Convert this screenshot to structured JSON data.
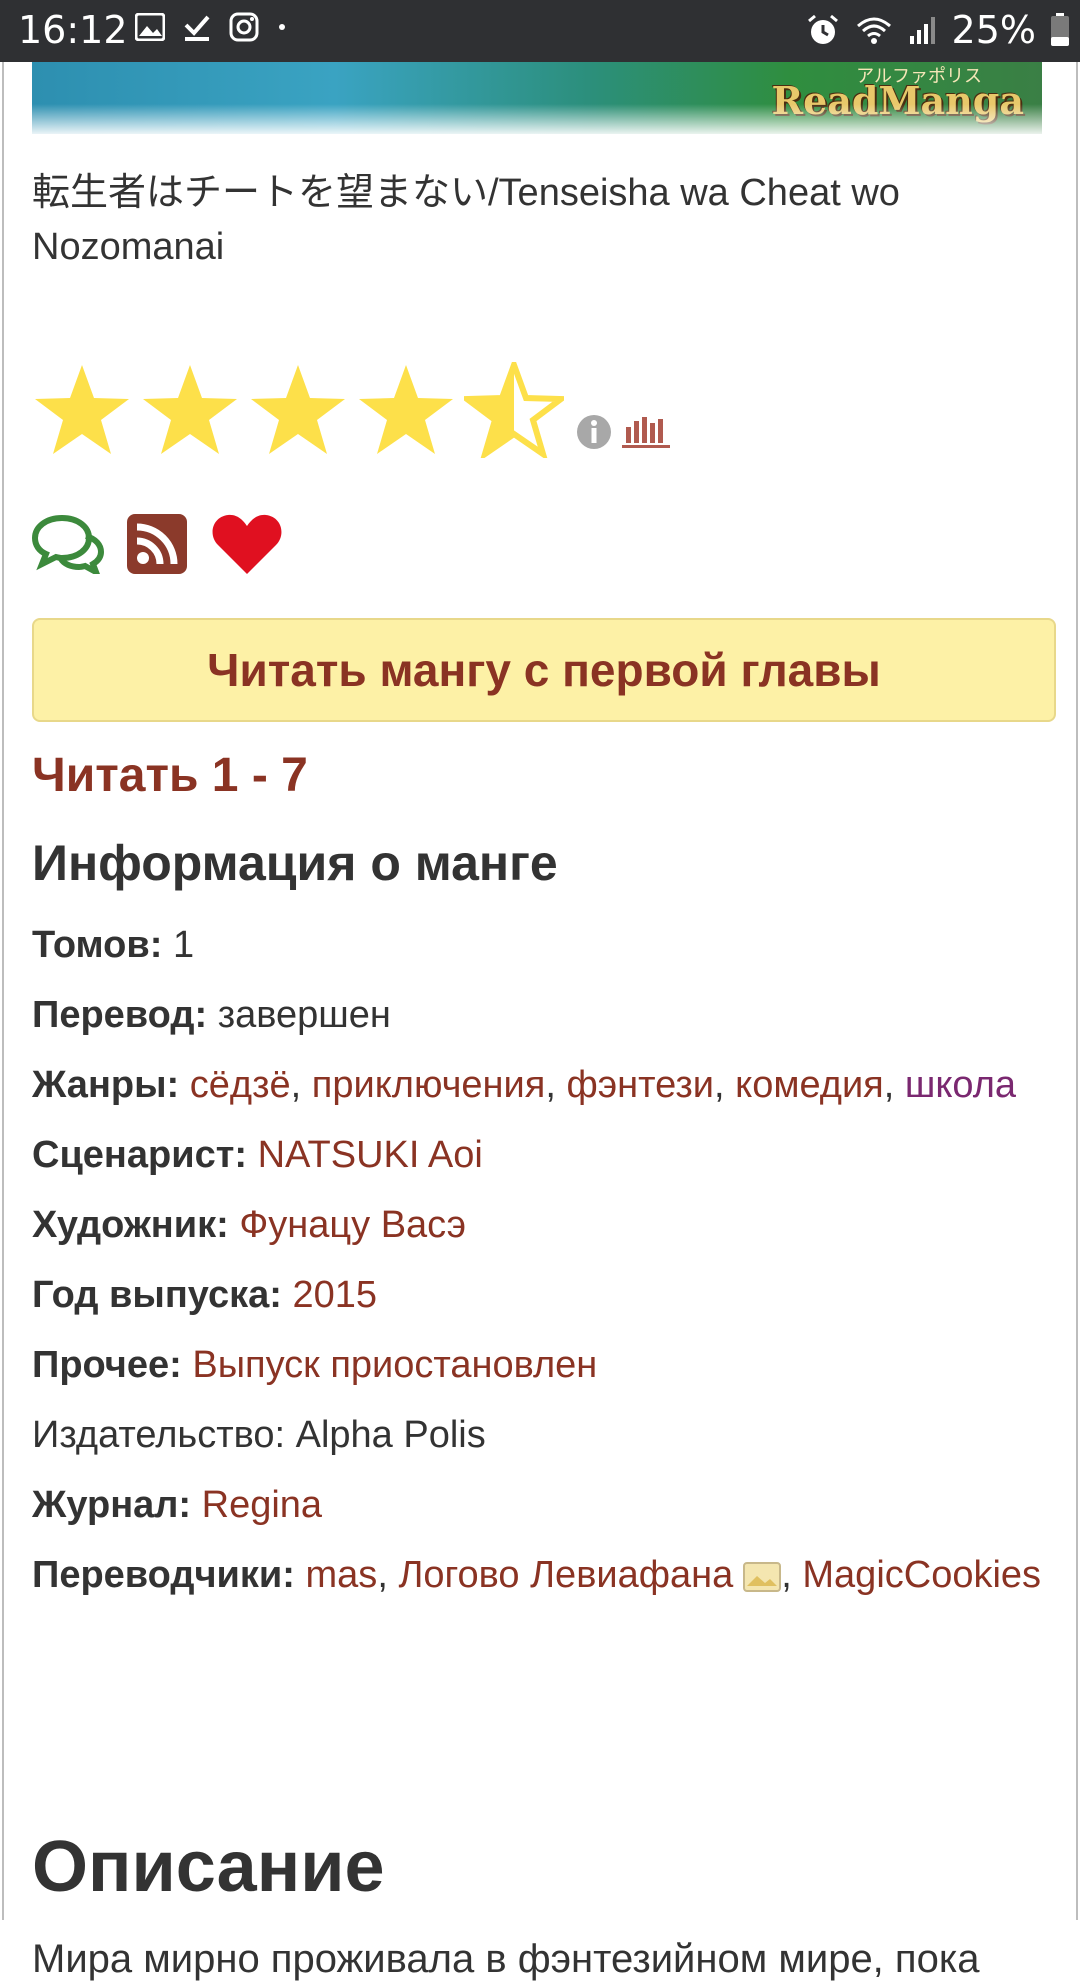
{
  "status_bar": {
    "time": "16:12",
    "battery": "25%",
    "icons": [
      "image-icon",
      "check-download-icon",
      "instagram-icon",
      "dot-icon",
      "alarm-icon",
      "wifi-icon",
      "signal-icon",
      "battery-icon"
    ]
  },
  "cover": {
    "logo_text": "ReadManga",
    "jp_text": "アルファポリス"
  },
  "manga": {
    "title": "転生者はチートを望まない/Tenseisha wa Cheat wo Nozomanai",
    "rating_stars": 4.5,
    "rating_max": 5
  },
  "actions": {
    "comments_icon": "comments-icon",
    "rss_icon": "rss-icon",
    "favorite_icon": "heart-icon"
  },
  "read_first_button": "Читать мангу с первой главы",
  "read_range": "Читать 1 - 7",
  "info": {
    "heading": "Информация о манге",
    "volumes_label": "Томов:",
    "volumes_value": "1",
    "translation_label": "Перевод:",
    "translation_value": "завершен",
    "genres_label": "Жанры:",
    "genres": [
      "сёдзё",
      "приключения",
      "фэнтези",
      "комедия",
      "школа"
    ],
    "writer_label": "Сценарист:",
    "writer_value": "NATSUKI Aoi",
    "artist_label": "Художник:",
    "artist_value": "Фунацу Васэ",
    "year_label": "Год выпуска:",
    "year_value": "2015",
    "other_label": "Прочее:",
    "other_value": "Выпуск приостановлен",
    "publisher_label": "Издательство:",
    "publisher_value": "Alpha Polis",
    "magazine_label": "Журнал:",
    "magazine_value": "Regina",
    "translators_label": "Переводчики:",
    "translators": [
      "mas",
      "Логово Левиафана",
      "MagicCookies"
    ]
  },
  "description": {
    "heading": "Описание",
    "text": "Мира мирно проживала в фэнтезийном мире, пока"
  },
  "colors": {
    "link": "#8a3323",
    "visited_link": "#7a2870",
    "star": "#fde04a",
    "button_bg": "#fdf1a6",
    "heart": "#e01020"
  }
}
